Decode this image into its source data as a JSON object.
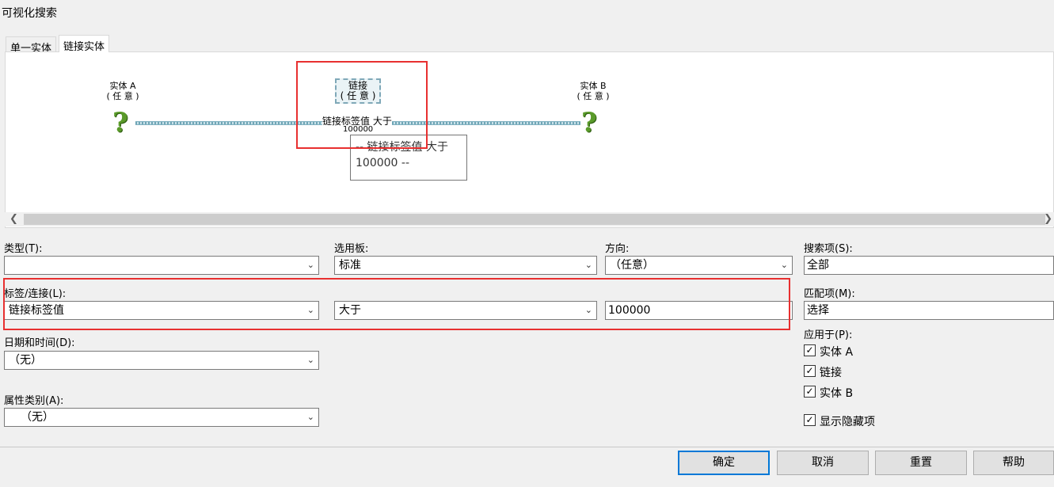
{
  "window": {
    "title": "可视化搜索"
  },
  "tabs": [
    {
      "label": "单一实体"
    },
    {
      "label": "链接实体"
    }
  ],
  "diagram": {
    "entity_a": {
      "name": "实体 A",
      "sub": "( 任 意 )"
    },
    "link": {
      "name": "链接",
      "sub": "( 任 意 )",
      "criteria": "链接标签值 大于",
      "value": "100000"
    },
    "entity_b": {
      "name": "实体 B",
      "sub": "( 任 意 )"
    },
    "tooltip": {
      "line1": "--  链接标签值 大于",
      "line2": "100000  --"
    }
  },
  "form": {
    "type_label": "类型(T):",
    "type_value": "",
    "palette_label": "选用板:",
    "palette_value": "标准",
    "direction_label": "方向:",
    "direction_value": "（任意）",
    "search_items_label": "搜索项(S):",
    "search_items_value": "全部",
    "tag_link_label": "标签/连接(L):",
    "tag_link_value": "链接标签值",
    "operator_value": "大于",
    "criteria_value": "100000",
    "match_label": "匹配项(M):",
    "match_value": "选择",
    "date_label": "日期和时间(D):",
    "date_value": "（无）",
    "attr_label": "属性类别(A):",
    "attr_value": "（无）",
    "apply_label": "应用于(P):",
    "apply_items": [
      {
        "label": "实体 A",
        "checked": true
      },
      {
        "label": "链接",
        "checked": true
      },
      {
        "label": "实体 B",
        "checked": true
      }
    ],
    "show_hidden_label": "显示隐藏项"
  },
  "buttons": {
    "ok": "确定",
    "cancel": "取消",
    "reset": "重置",
    "help": "帮助"
  },
  "colors": {
    "highlight": "#e83030",
    "accent": "#0078d7",
    "question": "#5a9a2a"
  }
}
